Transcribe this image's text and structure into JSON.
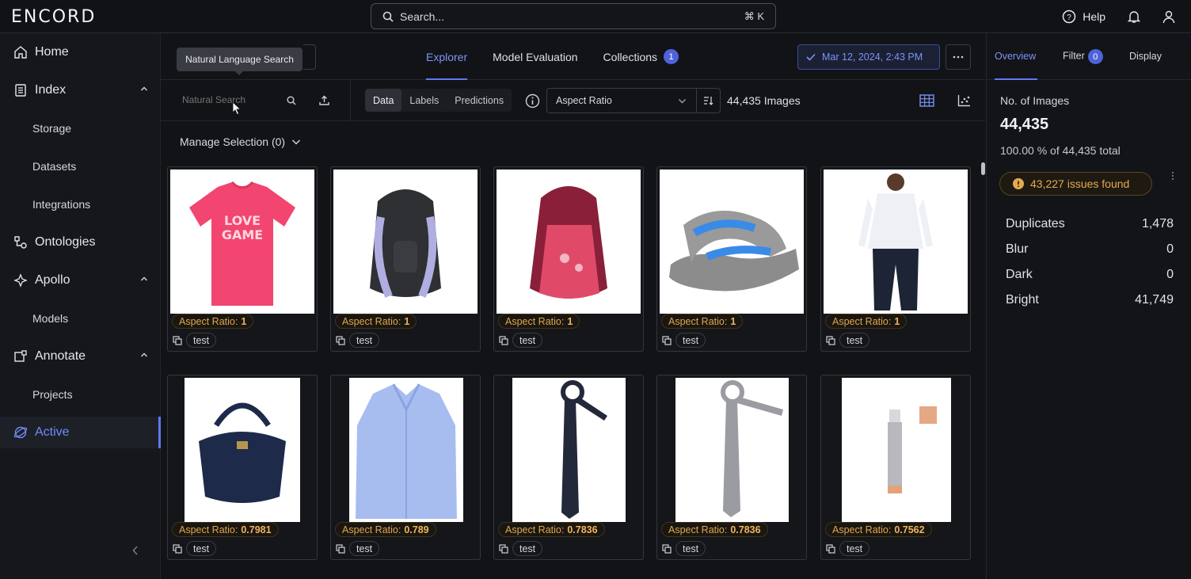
{
  "app": {
    "logo": "ENCORD"
  },
  "search": {
    "label": "Search...",
    "shortcut": "⌘ K"
  },
  "top": {
    "help": "Help"
  },
  "sidebar": {
    "items": [
      {
        "label": "Home",
        "icon": "home-icon"
      },
      {
        "label": "Index",
        "icon": "index-icon"
      },
      {
        "label": "Storage"
      },
      {
        "label": "Datasets"
      },
      {
        "label": "Integrations"
      },
      {
        "label": "Ontologies",
        "icon": "ontologies-icon"
      },
      {
        "label": "Apollo",
        "icon": "apollo-icon"
      },
      {
        "label": "Models"
      },
      {
        "label": "Annotate",
        "icon": "annotate-icon"
      },
      {
        "label": "Projects"
      },
      {
        "label": "Active",
        "icon": "active-icon"
      }
    ]
  },
  "main": {
    "tabs": [
      {
        "label": "Explorer"
      },
      {
        "label": "Model Evaluation"
      },
      {
        "label": "Collections",
        "badge": "1"
      }
    ],
    "date": "Mar 12, 2024, 2:43 PM",
    "tooltip": "Natural Language Search",
    "nl_placeholder": "Natural Search",
    "segments": [
      "Data",
      "Labels",
      "Predictions"
    ],
    "sort_field": "Aspect Ratio",
    "count": "44,435 Images",
    "manage": "Manage Selection (0)"
  },
  "cards": [
    {
      "ar_label": "Aspect Ratio:",
      "ar_value": "1",
      "tag": "test"
    },
    {
      "ar_label": "Aspect Ratio:",
      "ar_value": "1",
      "tag": "test"
    },
    {
      "ar_label": "Aspect Ratio:",
      "ar_value": "1",
      "tag": "test"
    },
    {
      "ar_label": "Aspect Ratio:",
      "ar_value": "1",
      "tag": "test"
    },
    {
      "ar_label": "Aspect Ratio:",
      "ar_value": "1",
      "tag": "test"
    },
    {
      "ar_label": "Aspect Ratio:",
      "ar_value": "0.7981",
      "tag": "test"
    },
    {
      "ar_label": "Aspect Ratio:",
      "ar_value": "0.789",
      "tag": "test"
    },
    {
      "ar_label": "Aspect Ratio:",
      "ar_value": "0.7836",
      "tag": "test"
    },
    {
      "ar_label": "Aspect Ratio:",
      "ar_value": "0.7836",
      "tag": "test"
    },
    {
      "ar_label": "Aspect Ratio:",
      "ar_value": "0.7562",
      "tag": "test"
    }
  ],
  "panel": {
    "tabs": {
      "overview": "Overview",
      "filter": "Filter",
      "filter_badge": "0",
      "display": "Display"
    },
    "stat_label": "No. of Images",
    "stat_value": "44,435",
    "stat_sub": "100.00 % of 44,435 total",
    "issues": "43,227 issues found",
    "metrics": [
      {
        "name": "Duplicates",
        "value": "1,478"
      },
      {
        "name": "Blur",
        "value": "0"
      },
      {
        "name": "Dark",
        "value": "0"
      },
      {
        "name": "Bright",
        "value": "41,749"
      }
    ]
  },
  "colors": {
    "accent": "#5f79f0",
    "warning": "#e6a94e"
  }
}
